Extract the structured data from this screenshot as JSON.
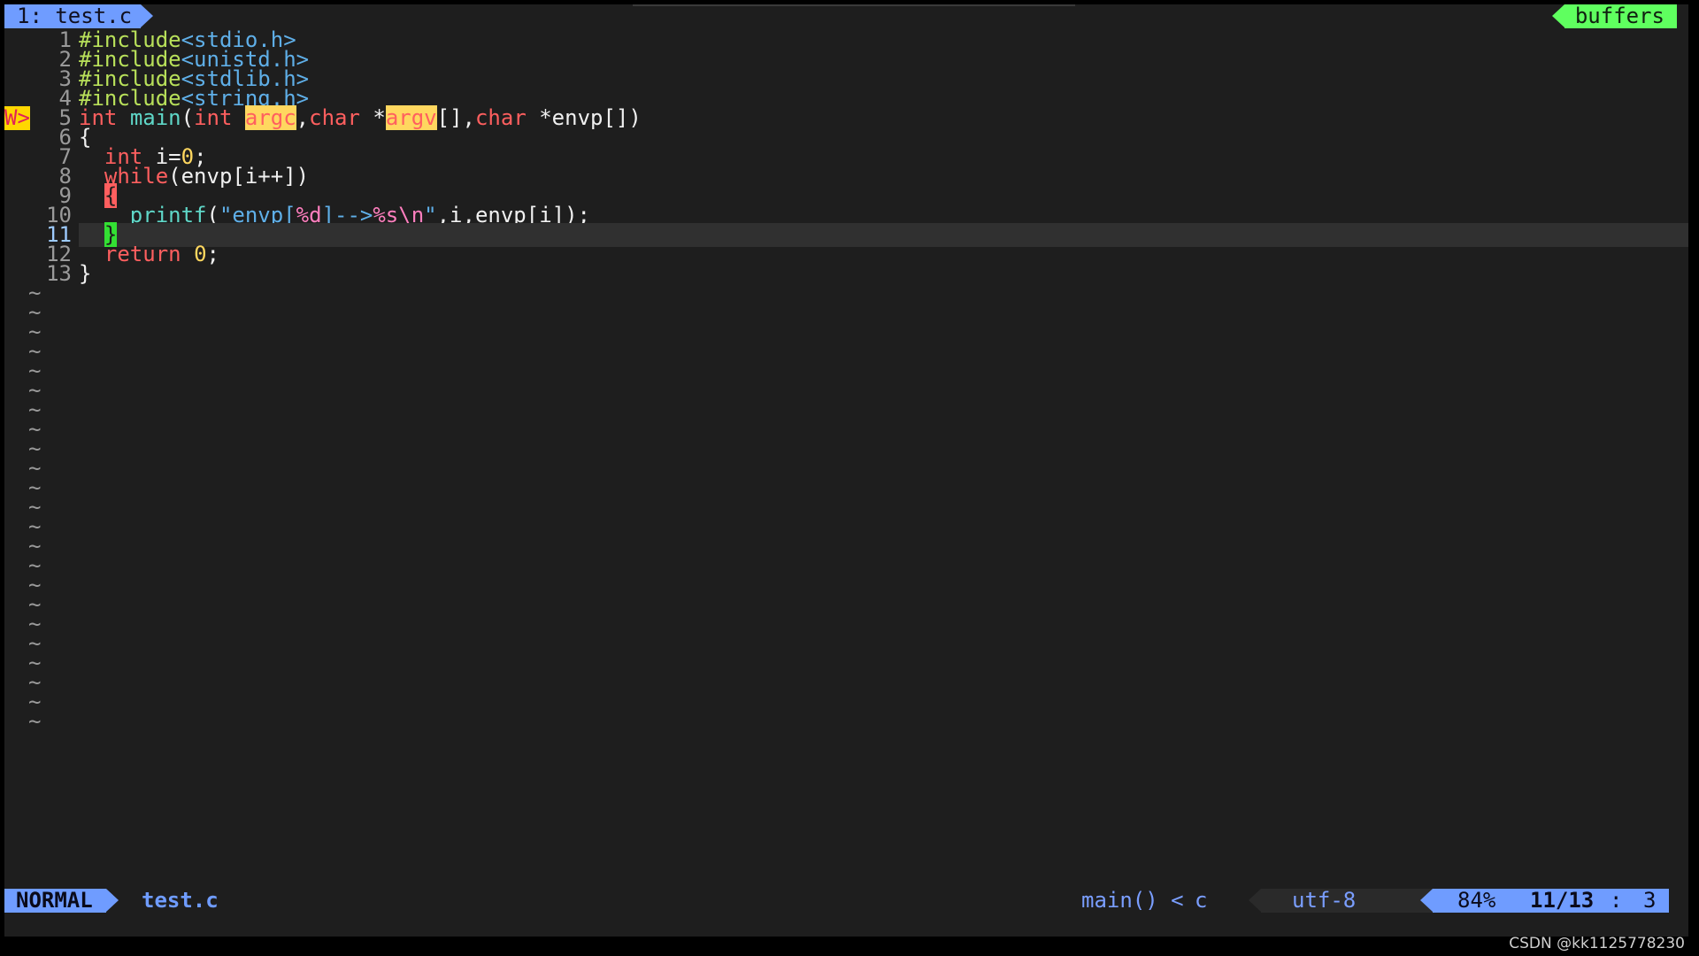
{
  "tabline": {
    "active_tab": "1: test.c",
    "right_label": "buffers"
  },
  "sign": "W>",
  "lines": [
    {
      "num": "1",
      "tokens": [
        {
          "c": "pp",
          "t": "#include"
        },
        {
          "c": "inc",
          "t": "<stdio.h>"
        }
      ]
    },
    {
      "num": "2",
      "tokens": [
        {
          "c": "pp",
          "t": "#include"
        },
        {
          "c": "inc",
          "t": "<unistd.h>"
        }
      ]
    },
    {
      "num": "3",
      "tokens": [
        {
          "c": "pp",
          "t": "#include"
        },
        {
          "c": "inc",
          "t": "<stdlib.h>"
        }
      ]
    },
    {
      "num": "4",
      "tokens": [
        {
          "c": "pp",
          "t": "#include"
        },
        {
          "c": "inc",
          "t": "<string.h>"
        }
      ]
    },
    {
      "num": "5",
      "sign": true,
      "tokens": [
        {
          "c": "kw",
          "t": "int"
        },
        {
          "c": "plain",
          "t": " "
        },
        {
          "c": "fn",
          "t": "main"
        },
        {
          "c": "plain",
          "t": "("
        },
        {
          "c": "kw",
          "t": "int"
        },
        {
          "c": "plain",
          "t": " "
        },
        {
          "c": "hl-word",
          "t": "argc"
        },
        {
          "c": "plain",
          "t": ","
        },
        {
          "c": "kw",
          "t": "char"
        },
        {
          "c": "plain",
          "t": " *"
        },
        {
          "c": "hl-word",
          "t": "argv"
        },
        {
          "c": "plain",
          "t": "[],"
        },
        {
          "c": "kw",
          "t": "char"
        },
        {
          "c": "plain",
          "t": " *envp[])"
        }
      ]
    },
    {
      "num": "6",
      "tokens": [
        {
          "c": "plain",
          "t": "{"
        }
      ]
    },
    {
      "num": "7",
      "tokens": [
        {
          "c": "plain",
          "t": "  "
        },
        {
          "c": "kw",
          "t": "int"
        },
        {
          "c": "plain",
          "t": " i="
        },
        {
          "c": "num",
          "t": "0"
        },
        {
          "c": "plain",
          "t": ";"
        }
      ]
    },
    {
      "num": "8",
      "tokens": [
        {
          "c": "plain",
          "t": "  "
        },
        {
          "c": "kw",
          "t": "while"
        },
        {
          "c": "plain",
          "t": "(envp[i++])"
        }
      ]
    },
    {
      "num": "9",
      "tokens": [
        {
          "c": "plain",
          "t": "  "
        },
        {
          "c": "brace-red",
          "t": "{"
        }
      ]
    },
    {
      "num": "10",
      "tokens": [
        {
          "c": "plain",
          "t": "    "
        },
        {
          "c": "fn",
          "t": "printf"
        },
        {
          "c": "plain",
          "t": "("
        },
        {
          "c": "str",
          "t": "\"envp["
        },
        {
          "c": "fmt",
          "t": "%d"
        },
        {
          "c": "str",
          "t": "]-->"
        },
        {
          "c": "fmt",
          "t": "%s\\n"
        },
        {
          "c": "str",
          "t": "\""
        },
        {
          "c": "plain",
          "t": ",i,envp[i]);"
        }
      ]
    },
    {
      "num": "11",
      "current": true,
      "tokens": [
        {
          "c": "plain",
          "t": "  "
        },
        {
          "c": "brace-green",
          "t": "}"
        }
      ]
    },
    {
      "num": "12",
      "tokens": [
        {
          "c": "plain",
          "t": "  "
        },
        {
          "c": "kw",
          "t": "return"
        },
        {
          "c": "plain",
          "t": " "
        },
        {
          "c": "num",
          "t": "0"
        },
        {
          "c": "plain",
          "t": ";"
        }
      ]
    },
    {
      "num": "13",
      "tokens": [
        {
          "c": "plain",
          "t": "}"
        }
      ]
    }
  ],
  "tilde": "~",
  "tilde_count": 23,
  "statusline": {
    "mode": "NORMAL",
    "filename": "test.c",
    "function": "main()",
    "function_sep": "<",
    "filetype": "c",
    "encoding": "utf-8",
    "percent": "84%",
    "line_pos": "11/13",
    "separator": ":",
    "column": "3"
  },
  "watermark": "CSDN @kk1125778230",
  "colors": {
    "background": "#1e1e1e",
    "accent_blue": "#6f9cff",
    "accent_green": "#5fff5f",
    "keyword": "#ff5f5f",
    "preprocessor": "#b8e05a",
    "include_path": "#5fafe8",
    "function": "#5fd7c8",
    "number": "#ffd75f"
  }
}
